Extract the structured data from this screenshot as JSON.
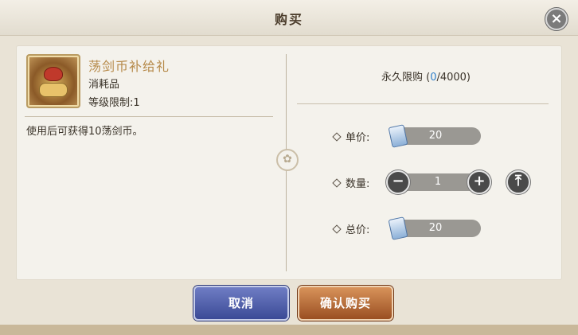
{
  "dialog": {
    "title": "购买",
    "close_icon": "×"
  },
  "item": {
    "name": "荡剑币补给礼",
    "type": "消耗品",
    "level_limit": "等级限制:1",
    "description": "使用后可获得10荡剑币。"
  },
  "purchase": {
    "limit_prefix": "永久限购 (",
    "limit_current": "0",
    "limit_suffix": "/4000)",
    "unit_price_label": "单价:",
    "unit_price": "20",
    "quantity_label": "数量:",
    "quantity": "1",
    "total_label": "总价:",
    "total_price": "20",
    "minus_symbol": "−",
    "plus_symbol": "+",
    "max_symbol": "⤒"
  },
  "buttons": {
    "cancel": "取消",
    "confirm": "确认购买"
  },
  "colors": {
    "item_name": "#b68a4a",
    "limit_current": "#2f7fc9",
    "cancel_button": "#3b4a96",
    "confirm_button": "#9a4f22"
  },
  "icons": {
    "close": "close-icon",
    "currency": "ticket-icon",
    "minus": "minus-icon",
    "plus": "plus-icon",
    "max": "max-icon",
    "divider": "ornament-icon"
  }
}
